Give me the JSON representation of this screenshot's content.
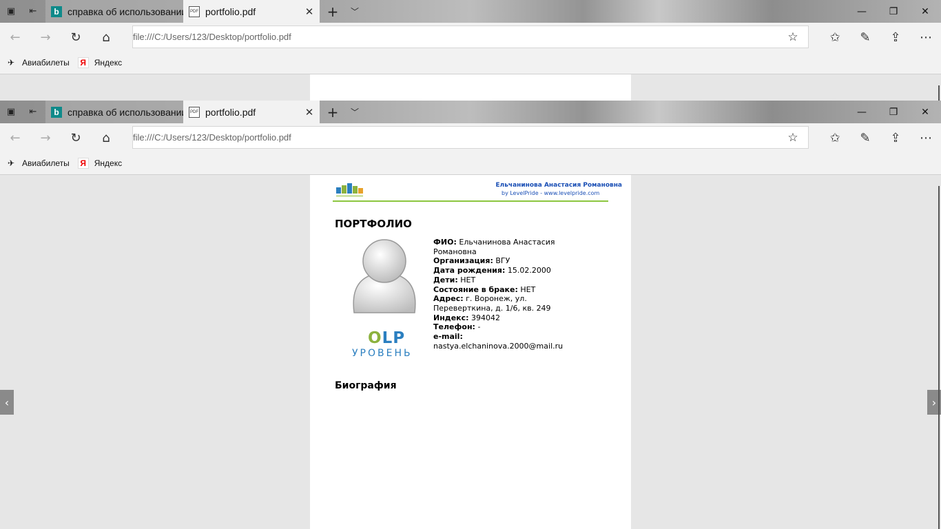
{
  "tabs": [
    {
      "label": "справка об использовании",
      "icon": "bing-icon"
    },
    {
      "label": "portfolio.pdf",
      "icon": "pdf-icon"
    }
  ],
  "address": {
    "url": "file:///C:/Users/123/Desktop/portfolio.pdf"
  },
  "favorites": [
    {
      "label": "Авиабилеты",
      "icon": "plane-icon"
    },
    {
      "label": "Яндекс",
      "icon": "yandex-icon"
    }
  ],
  "pdf": {
    "header_name": "Ельчанинова Анастасия Романовна",
    "header_sub": "by LevelPride - www.levelpride.com",
    "title": "ПОРТФОЛИО",
    "olp_o": "O",
    "olp_lp": "LP",
    "level_label": "УРОВЕНЬ",
    "fields": {
      "fio_label": "ФИО:",
      "fio_value": "Ельчанинова Анастасия Романовна",
      "org_label": "Организация:",
      "org_value": "ВГУ",
      "dob_label": "Дата рождения:",
      "dob_value": "15.02.2000",
      "kids_label": "Дети:",
      "kids_value": "НЕТ",
      "married_label": "Состояние в браке:",
      "married_value": "НЕТ",
      "addr_label": "Адрес:",
      "addr_value": "г. Воронеж, ул. Переверткина, д. 1/6, кв. 249",
      "index_label": "Индекс:",
      "index_value": "394042",
      "phone_label": "Телефон:",
      "phone_value": "-",
      "email_label": "e-mail:",
      "email_value": "nastya.elchaninova.2000@mail.ru"
    },
    "bio_heading": "Биография"
  }
}
